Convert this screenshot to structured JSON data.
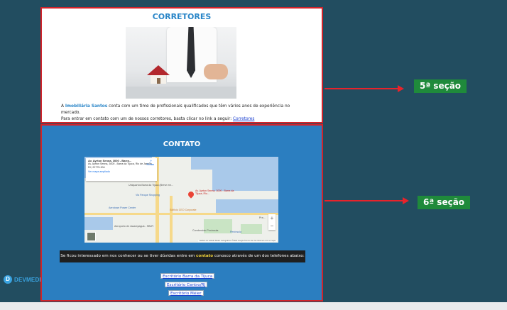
{
  "section5": {
    "title": "CORRETORES",
    "text_prefix": "A ",
    "brand": "Imobiliária Santos",
    "text_rest": " conta com um time de profissionais qualificados que têm vários anos de experiência no mercado.",
    "text_line2": "Para entrar em contato com um de nossos corretores, basta clicar no link a seguir: ",
    "link": "Corretores"
  },
  "section6": {
    "title": "CONTATO",
    "map": {
      "card_title": "Av. Ayrton Senna, 3000 - Barra...",
      "card_address": "Av. Ayrton Senna, 3000 - Barra da Tijuca, Rio de Janeiro - RJ, 22775-904",
      "card_link": "Ver mapa ampliado",
      "directions": "Rotas",
      "pin_label": "Av. Ayrton Senna, 3000 - Barra da Tijuca, Rio...",
      "labels": [
        "Uniquartos Barra da Tijuca (Breve em...",
        "Via Parque Shopping",
        "Aerotown Power Center",
        "Edifício CEO Corporate",
        "Aeroporto de Jacarepaguá - SBJR",
        "Condomínio Península",
        "Península",
        "Pra..."
      ],
      "attribution": "Atalhos do teclado   Dados cartográficos ©2022 Google   Termos de Uso   Informar erro no mapa"
    },
    "notice_before": "Se ficou interessado em nos conhecer ou se tiver dúvidas entre em ",
    "notice_highlight": "contato",
    "notice_after": " conosco através de um dos telefones abaixo:",
    "buttons": [
      "Escritório Barra da Tijuca",
      "Escritório Centro/RJ",
      "Escritório Méier"
    ]
  },
  "annotations": {
    "label5": "5ª seção",
    "label6": "6ª seção",
    "arrow_color": "#e8232b",
    "label_color": "#1f8a3b"
  },
  "logo": {
    "mark": "D",
    "text": "DEVMEDI"
  },
  "colors": {
    "background": "#224d60",
    "section6": "#2b7ec0",
    "border": "#d2232a"
  }
}
